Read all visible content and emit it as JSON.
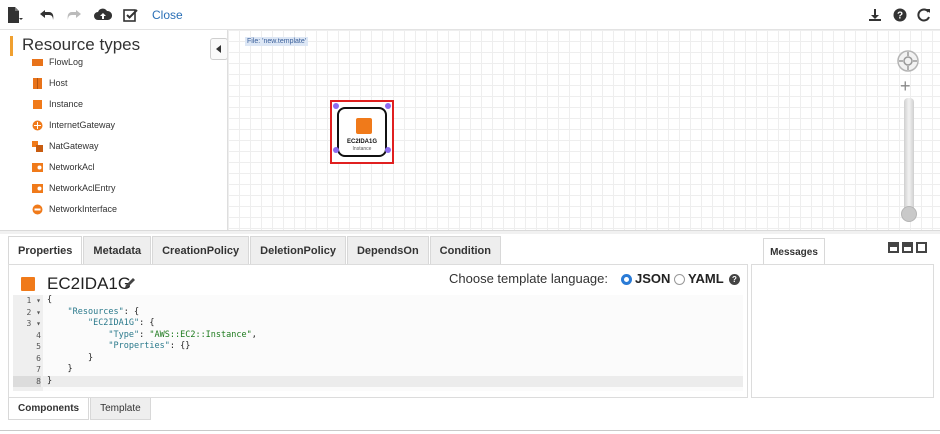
{
  "toolbar": {
    "close_label": "Close",
    "icons": [
      "new-file-icon",
      "undo-icon",
      "redo-icon",
      "cloud-upload-icon",
      "validate-icon",
      "download-icon",
      "help-icon",
      "refresh-icon"
    ]
  },
  "resource_panel": {
    "title": "Resource types",
    "items": [
      {
        "label": "FlowLog",
        "icon": "flowlog-icon"
      },
      {
        "label": "Host",
        "icon": "host-icon"
      },
      {
        "label": "Instance",
        "icon": "instance-icon"
      },
      {
        "label": "InternetGateway",
        "icon": "internet-gateway-icon"
      },
      {
        "label": "NatGateway",
        "icon": "nat-gateway-icon"
      },
      {
        "label": "NetworkAcl",
        "icon": "network-acl-icon"
      },
      {
        "label": "NetworkAclEntry",
        "icon": "network-acl-entry-icon"
      },
      {
        "label": "NetworkInterface",
        "icon": "network-interface-icon"
      }
    ]
  },
  "canvas": {
    "file_label": "File: 'new.template'",
    "node": {
      "name": "EC2IDA1G",
      "type": "Instance"
    }
  },
  "properties": {
    "tabs": [
      "Properties",
      "Metadata",
      "CreationPolicy",
      "DeletionPolicy",
      "DependsOn",
      "Condition"
    ],
    "active_tab": "Properties",
    "resource_name": "EC2IDA1G",
    "language_prompt": "Choose template language:",
    "languages": [
      "JSON",
      "YAML"
    ],
    "selected_language": "JSON",
    "code_lines": [
      {
        "num": "1",
        "fold": "▾"
      },
      {
        "num": "2",
        "fold": "▾"
      },
      {
        "num": "3",
        "fold": "▾"
      },
      {
        "num": "4",
        "fold": ""
      },
      {
        "num": "5",
        "fold": ""
      },
      {
        "num": "6",
        "fold": ""
      },
      {
        "num": "7",
        "fold": ""
      },
      {
        "num": "8",
        "fold": ""
      }
    ],
    "code": {
      "l1": "{",
      "l2_key": "\"Resources\"",
      "l2_rest": ": {",
      "l3_key": "\"EC2IDA1G\"",
      "l3_rest": ": {",
      "l4_key": "\"Type\"",
      "l4_sep": ": ",
      "l4_val": "\"AWS::EC2::Instance\"",
      "l4_end": ",",
      "l5_key": "\"Properties\"",
      "l5_rest": ": {}",
      "l6": "}",
      "l7": "}",
      "l8": "}"
    }
  },
  "messages": {
    "tab_label": "Messages"
  },
  "bottom_tabs": [
    "Components",
    "Template"
  ],
  "colors": {
    "accent_orange": "#f07a1a",
    "link_blue": "#2a6fb6",
    "selection_red": "#e02020",
    "handle_purple": "#8c6cf0"
  }
}
